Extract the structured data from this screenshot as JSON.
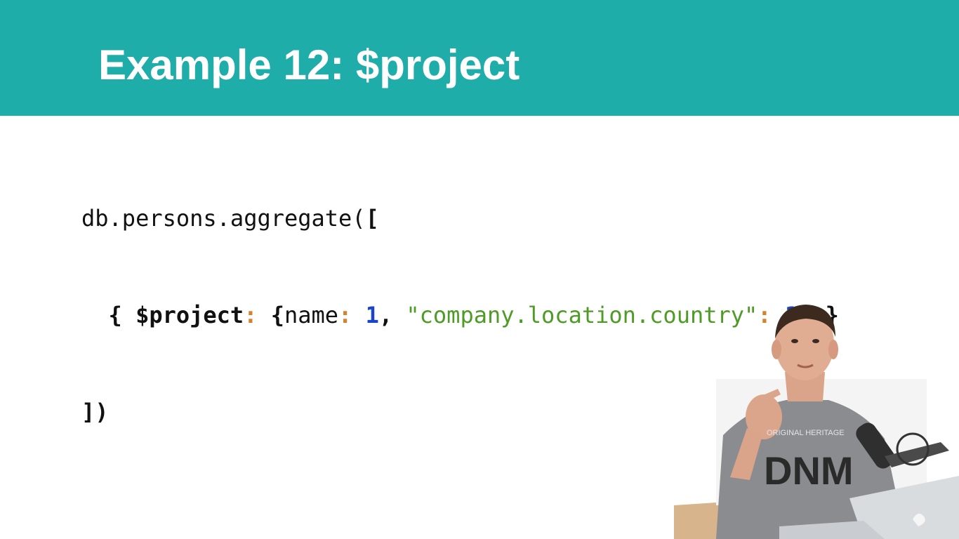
{
  "slide": {
    "title": "Example 12: $project",
    "header_color": "#1fada9"
  },
  "code": {
    "line1": {
      "prefix": "db.persons.aggregate(",
      "bracket": "["
    },
    "line2": {
      "indent": "  ",
      "open_brace": "{ ",
      "operator": "$project",
      "colon1": ":",
      "space1": " ",
      "inner_open": "{",
      "field1": "name",
      "colon2": ":",
      "space2": " ",
      "value1": "1",
      "comma": ", ",
      "field2": "\"company.location.country\"",
      "colon3": ":",
      "space3": " ",
      "value2": "1",
      "inner_close": "}",
      "space4": " ",
      "close_brace": "}"
    },
    "line3": {
      "close": "])"
    },
    "colors": {
      "text": "#111111",
      "operator_colon": "#d5822f",
      "number": "#1a45c8",
      "string": "#4e9b26"
    }
  },
  "presenter": {
    "shirt_text_top": "ORIGINAL HERITAGE",
    "shirt_text_bottom": "DNM"
  }
}
